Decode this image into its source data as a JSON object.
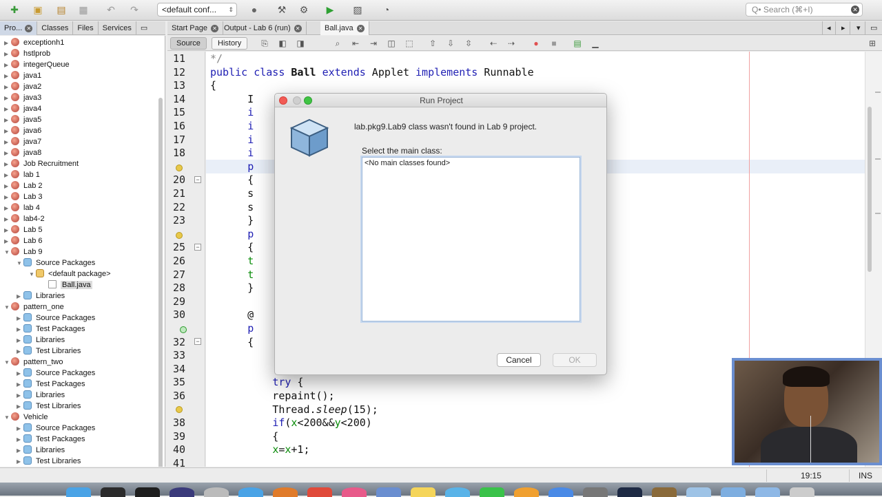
{
  "toolbar": {
    "config_select": "<default conf...",
    "search_placeholder": "Q• Search (⌘+I)"
  },
  "left_panel": {
    "tabs": [
      {
        "label": "Pro..."
      },
      {
        "label": "Classes"
      },
      {
        "label": "Files"
      },
      {
        "label": "Services"
      }
    ],
    "tree": [
      {
        "label": "exceptionh1",
        "icon": "project-icon",
        "depth": 0,
        "expanded": false
      },
      {
        "label": "hstlprob",
        "icon": "project-icon",
        "depth": 0,
        "expanded": false
      },
      {
        "label": "integerQueue",
        "icon": "project-icon",
        "depth": 0,
        "expanded": false
      },
      {
        "label": "java1",
        "icon": "project-icon",
        "depth": 0,
        "expanded": false
      },
      {
        "label": "java2",
        "icon": "project-icon",
        "depth": 0,
        "expanded": false
      },
      {
        "label": "java3",
        "icon": "project-icon",
        "depth": 0,
        "expanded": false
      },
      {
        "label": "java4",
        "icon": "project-icon",
        "depth": 0,
        "expanded": false
      },
      {
        "label": "java5",
        "icon": "project-icon",
        "depth": 0,
        "expanded": false
      },
      {
        "label": "java6",
        "icon": "project-icon",
        "depth": 0,
        "expanded": false
      },
      {
        "label": "java7",
        "icon": "project-icon",
        "depth": 0,
        "expanded": false
      },
      {
        "label": "java8",
        "icon": "project-icon",
        "depth": 0,
        "expanded": false
      },
      {
        "label": "Job Recruitment",
        "icon": "project-icon",
        "depth": 0,
        "expanded": false
      },
      {
        "label": "lab 1",
        "icon": "project-icon",
        "depth": 0,
        "expanded": false
      },
      {
        "label": "Lab 2",
        "icon": "project-icon",
        "depth": 0,
        "expanded": false
      },
      {
        "label": "Lab 3",
        "icon": "project-icon",
        "depth": 0,
        "expanded": false
      },
      {
        "label": "lab 4",
        "icon": "project-icon",
        "depth": 0,
        "expanded": false
      },
      {
        "label": "lab4-2",
        "icon": "project-icon",
        "depth": 0,
        "expanded": false
      },
      {
        "label": "Lab 5",
        "icon": "project-icon",
        "depth": 0,
        "expanded": false
      },
      {
        "label": "Lab 6",
        "icon": "project-icon",
        "depth": 0,
        "expanded": false
      },
      {
        "label": "Lab 9",
        "icon": "project-icon",
        "depth": 0,
        "expanded": true
      },
      {
        "label": "Source Packages",
        "icon": "package-icon",
        "depth": 1,
        "expanded": true
      },
      {
        "label": "<default package>",
        "icon": "folder-icon",
        "depth": 2,
        "expanded": true
      },
      {
        "label": "Ball.java",
        "icon": "file-icon",
        "depth": 3,
        "expanded": null,
        "selected": true
      },
      {
        "label": "Libraries",
        "icon": "package-icon",
        "depth": 1,
        "expanded": false
      },
      {
        "label": "pattern_one",
        "icon": "project-icon",
        "depth": 0,
        "expanded": true
      },
      {
        "label": "Source Packages",
        "icon": "package-icon",
        "depth": 1,
        "expanded": false
      },
      {
        "label": "Test Packages",
        "icon": "package-icon",
        "depth": 1,
        "expanded": false
      },
      {
        "label": "Libraries",
        "icon": "package-icon",
        "depth": 1,
        "expanded": false
      },
      {
        "label": "Test Libraries",
        "icon": "package-icon",
        "depth": 1,
        "expanded": false
      },
      {
        "label": "pattern_two",
        "icon": "project-icon",
        "depth": 0,
        "expanded": true
      },
      {
        "label": "Source Packages",
        "icon": "package-icon",
        "depth": 1,
        "expanded": false
      },
      {
        "label": "Test Packages",
        "icon": "package-icon",
        "depth": 1,
        "expanded": false
      },
      {
        "label": "Libraries",
        "icon": "package-icon",
        "depth": 1,
        "expanded": false
      },
      {
        "label": "Test Libraries",
        "icon": "package-icon",
        "depth": 1,
        "expanded": false
      },
      {
        "label": "Vehicle",
        "icon": "project-icon",
        "depth": 0,
        "expanded": true
      },
      {
        "label": "Source Packages",
        "icon": "package-icon",
        "depth": 1,
        "expanded": false
      },
      {
        "label": "Test Packages",
        "icon": "package-icon",
        "depth": 1,
        "expanded": false
      },
      {
        "label": "Libraries",
        "icon": "package-icon",
        "depth": 1,
        "expanded": false
      },
      {
        "label": "Test Libraries",
        "icon": "package-icon",
        "depth": 1,
        "expanded": false
      }
    ]
  },
  "editor": {
    "tabs": [
      {
        "label": "Start Page"
      },
      {
        "label": "Output - Lab 6 (run)"
      },
      {
        "label": "Ball.java"
      }
    ],
    "source_label": "Source",
    "history_label": "History",
    "lines": [
      {
        "num": "11",
        "html": "<span class=\"cm\">*/</span>"
      },
      {
        "num": "12",
        "html": "<span class=\"kw\">public class</span> <span class=\"b\">Ball</span> <span class=\"kw\">extends</span> Applet <span class=\"kw\">implements</span> Runnable"
      },
      {
        "num": "13",
        "html": "{"
      },
      {
        "num": "14",
        "html": "      I"
      },
      {
        "num": "15",
        "html": "      <span class=\"kw\">i</span>"
      },
      {
        "num": "16",
        "html": "      <span class=\"kw\">i</span>"
      },
      {
        "num": "17",
        "html": "      <span class=\"kw\">i</span>"
      },
      {
        "num": "18",
        "html": "      <span class=\"kw\">i</span>"
      },
      {
        "num": "",
        "html": "      <span class=\"kw\">p</span>"
      },
      {
        "num": "20",
        "html": "      {"
      },
      {
        "num": "21",
        "html": "      s"
      },
      {
        "num": "22",
        "html": "      s"
      },
      {
        "num": "23",
        "html": "      }"
      },
      {
        "num": "",
        "html": "      <span class=\"kw\">p</span>"
      },
      {
        "num": "25",
        "html": "      {"
      },
      {
        "num": "26",
        "html": "      <span class=\"fld\">t</span>"
      },
      {
        "num": "27",
        "html": "      <span class=\"fld\">t</span>"
      },
      {
        "num": "28",
        "html": "      }"
      },
      {
        "num": "29",
        "html": ""
      },
      {
        "num": "30",
        "html": "      @"
      },
      {
        "num": "",
        "html": "      <span class=\"kw\">p</span>"
      },
      {
        "num": "32",
        "html": "      {"
      },
      {
        "num": "33",
        "html": ""
      },
      {
        "num": "34",
        "html": ""
      },
      {
        "num": "35",
        "html": "          <span class=\"kw\">try</span> {"
      },
      {
        "num": "36",
        "html": "          repaint();"
      },
      {
        "num": "",
        "html": "          Thread.<span class=\"it\">sleep</span>(15);"
      },
      {
        "num": "38",
        "html": "          <span class=\"kw\">if</span>(<span class=\"fld\">x</span>&lt;200&amp;&amp;<span class=\"fld\">y</span>&lt;200)"
      },
      {
        "num": "39",
        "html": "          {"
      },
      {
        "num": "40",
        "html": "          <span class=\"fld\">x</span>=<span class=\"fld\">x</span>+1;"
      },
      {
        "num": "41",
        "html": ""
      }
    ]
  },
  "dialog": {
    "title": "Run Project",
    "message": "lab.pkg9.Lab9 class wasn't found in Lab 9 project.",
    "select_label": "Select the main class:",
    "list_item": "<No main classes found>",
    "cancel_label": "Cancel",
    "ok_label": "OK"
  },
  "status": {
    "position": "19:15",
    "mode": "INS"
  }
}
